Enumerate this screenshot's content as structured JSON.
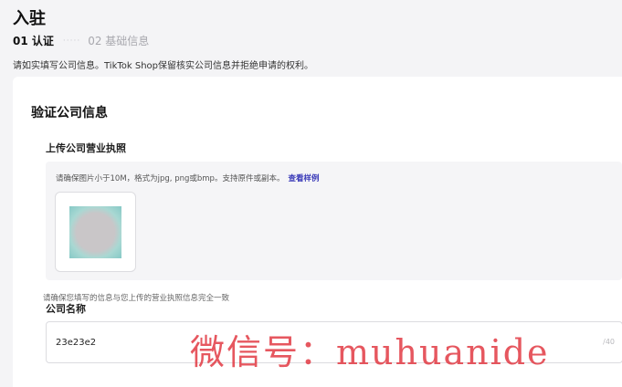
{
  "header": {
    "title": "入驻",
    "steps": [
      {
        "label": "01 认证",
        "active": true
      },
      {
        "label": "02 基础信息",
        "active": false
      }
    ],
    "notice": "请如实填写公司信息。TikTok Shop保留核实公司信息并拒绝申请的权利。"
  },
  "card": {
    "section_title": "验证公司信息",
    "license": {
      "label": "上传公司营业执照",
      "hint": "请确保图片小于10M，格式为jpg, png或bmp。支持原件或副本。",
      "sample_link": "查看样例"
    },
    "company_name": {
      "label": "公司名称",
      "value": "23e23e2",
      "char_count": "/40",
      "hint": "请确保您填写的信息与您上传的营业执照信息完全一致"
    }
  },
  "watermark": "微信号：muhuanide",
  "colors": {
    "link": "#3a3ab8",
    "watermark": "#e1323c",
    "background": "#f4f4f6"
  }
}
